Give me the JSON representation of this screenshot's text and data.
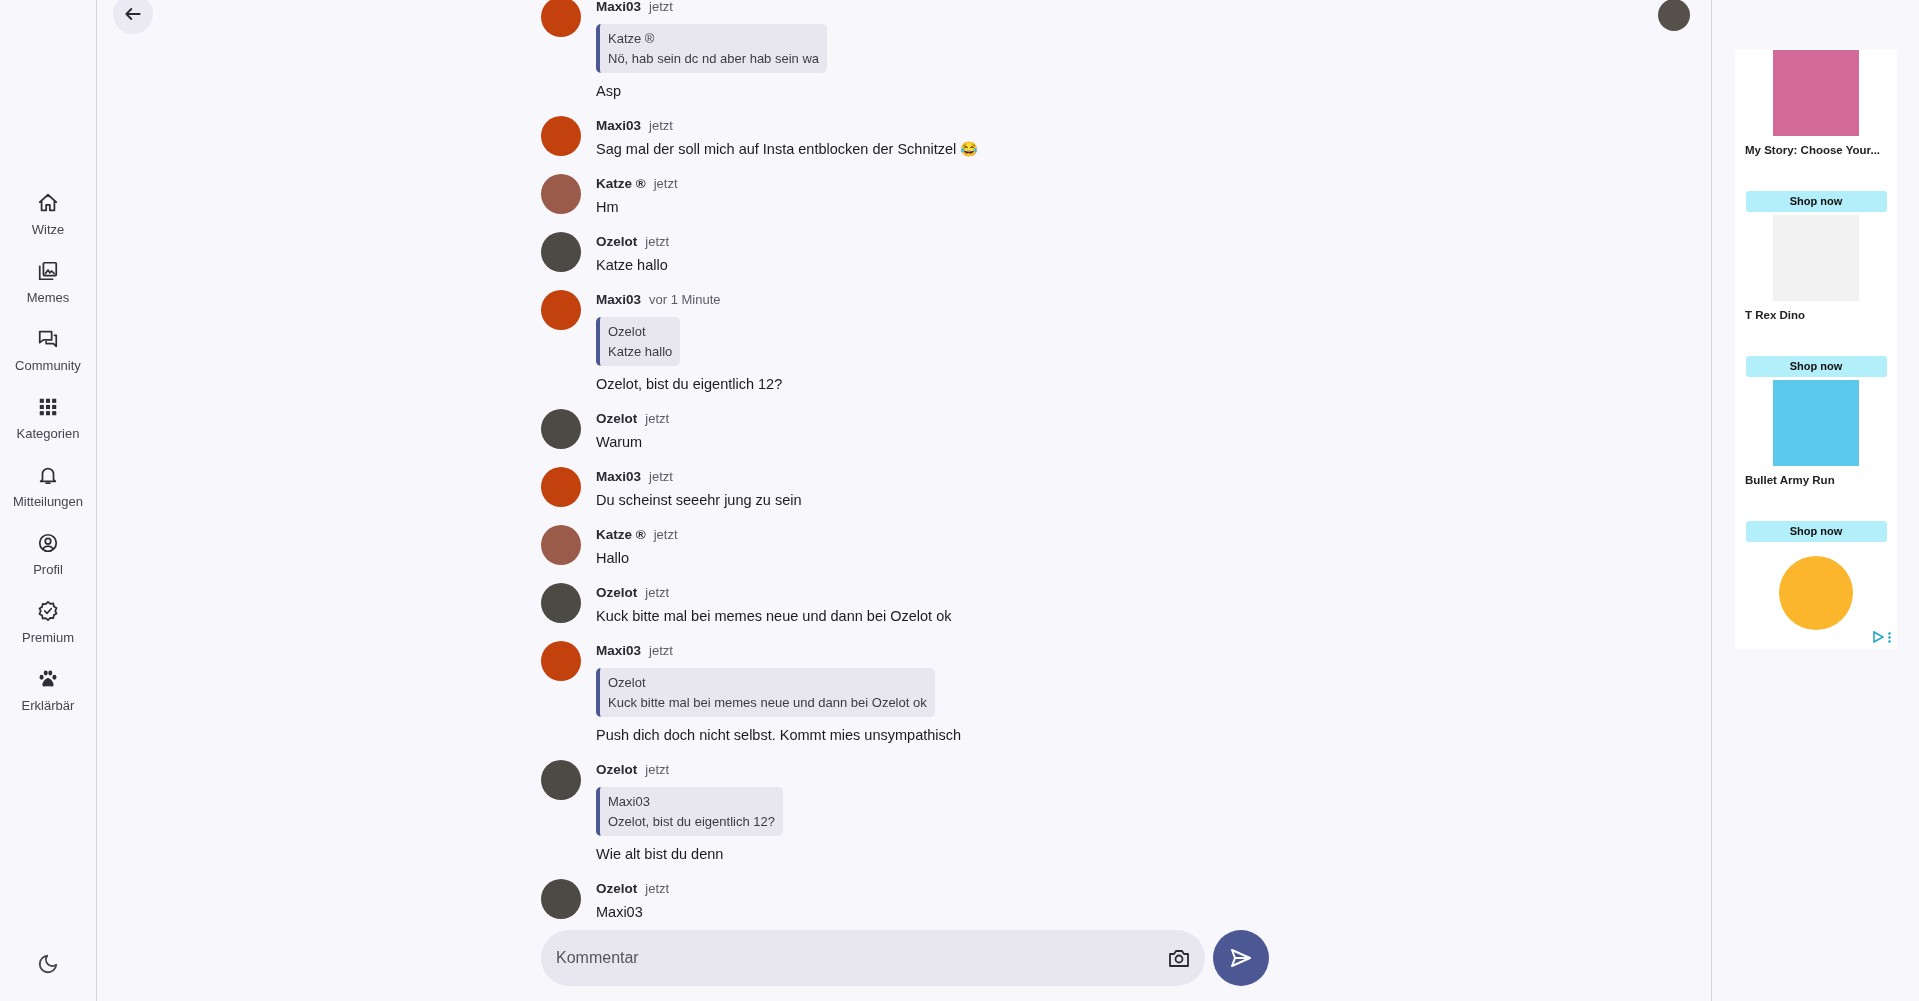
{
  "nav": [
    {
      "label": "Witze"
    },
    {
      "label": "Memes"
    },
    {
      "label": "Community"
    },
    {
      "label": "Kategorien"
    },
    {
      "label": "Mitteilungen"
    },
    {
      "label": "Profil"
    },
    {
      "label": "Premium"
    },
    {
      "label": "Erklärbär"
    }
  ],
  "messages": [
    {
      "author": "Maxi03",
      "time": "jetzt",
      "color": "#c2410c",
      "quote": {
        "author": "Katze ®",
        "text": "Nö, hab sein dc nd aber hab sein wa"
      },
      "text": "Asp"
    },
    {
      "author": "Maxi03",
      "time": "jetzt",
      "color": "#c2410c",
      "text": "Sag mal der soll mich auf Insta entblocken der Schnitzel 😂"
    },
    {
      "author": "Katze ®",
      "time": "jetzt",
      "color": "#9a5b4a",
      "text": "Hm"
    },
    {
      "author": "Ozelot",
      "time": "jetzt",
      "color": "#4b4a45",
      "text": "Katze hallo"
    },
    {
      "author": "Maxi03",
      "time": "vor 1 Minute",
      "color": "#c2410c",
      "quote": {
        "author": "Ozelot",
        "text": "Katze hallo"
      },
      "text": "Ozelot, bist du eigentlich 12?"
    },
    {
      "author": "Ozelot",
      "time": "jetzt",
      "color": "#4b4a45",
      "text": "Warum"
    },
    {
      "author": "Maxi03",
      "time": "jetzt",
      "color": "#c2410c",
      "text": "Du scheinst seeehr jung zu sein"
    },
    {
      "author": "Katze ®",
      "time": "jetzt",
      "color": "#9a5b4a",
      "text": "Hallo"
    },
    {
      "author": "Ozelot",
      "time": "jetzt",
      "color": "#4b4a45",
      "text": "Kuck bitte mal bei memes neue und dann bei Ozelot ok"
    },
    {
      "author": "Maxi03",
      "time": "jetzt",
      "color": "#c2410c",
      "quote": {
        "author": "Ozelot",
        "text": "Kuck bitte mal bei memes neue und dann bei Ozelot ok"
      },
      "text": "Push dich doch nicht selbst. Kommt mies unsympathisch"
    },
    {
      "author": "Ozelot",
      "time": "jetzt",
      "color": "#4b4a45",
      "quote": {
        "author": "Maxi03",
        "text": "Ozelot, bist du eigentlich 12?"
      },
      "text": "Wie alt bist du denn"
    },
    {
      "author": "Ozelot",
      "time": "jetzt",
      "color": "#4b4a45",
      "text": "Maxi03"
    }
  ],
  "composer": {
    "placeholder": "Kommentar"
  },
  "ads": [
    {
      "title": "My Story: Choose Your...",
      "button": "Shop now"
    },
    {
      "title": "T Rex Dino",
      "button": "Shop now"
    },
    {
      "title": "Bullet Army Run",
      "button": "Shop now"
    }
  ]
}
